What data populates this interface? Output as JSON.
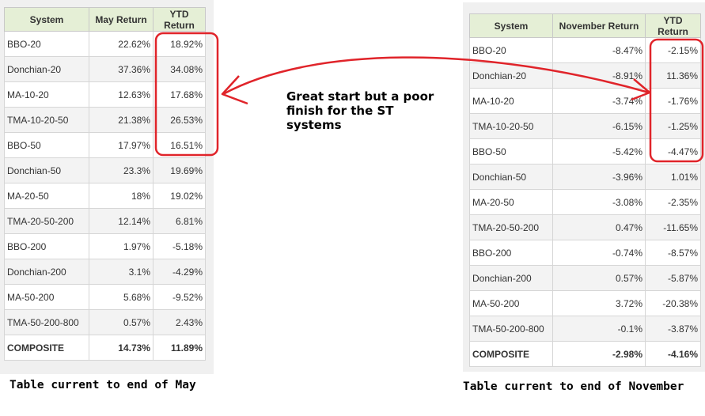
{
  "annotation": "Great start but a poor finish for the ST systems",
  "colors": {
    "header_bg": "#e5efd6",
    "annotation_red": "#e0242a",
    "panel_bg": "#f0f0f0"
  },
  "may_table": {
    "caption": "Table current to end of May",
    "headers": [
      "System",
      "May Return",
      "YTD Return"
    ],
    "rows": [
      {
        "system": "BBO-20",
        "period": "22.62%",
        "ytd": "18.92%"
      },
      {
        "system": "Donchian-20",
        "period": "37.36%",
        "ytd": "34.08%"
      },
      {
        "system": "MA-10-20",
        "period": "12.63%",
        "ytd": "17.68%"
      },
      {
        "system": "TMA-10-20-50",
        "period": "21.38%",
        "ytd": "26.53%"
      },
      {
        "system": "BBO-50",
        "period": "17.97%",
        "ytd": "16.51%"
      },
      {
        "system": "Donchian-50",
        "period": "23.3%",
        "ytd": "19.69%"
      },
      {
        "system": "MA-20-50",
        "period": "18%",
        "ytd": "19.02%"
      },
      {
        "system": "TMA-20-50-200",
        "period": "12.14%",
        "ytd": "6.81%"
      },
      {
        "system": "BBO-200",
        "period": "1.97%",
        "ytd": "-5.18%"
      },
      {
        "system": "Donchian-200",
        "period": "3.1%",
        "ytd": "-4.29%"
      },
      {
        "system": "MA-50-200",
        "period": "5.68%",
        "ytd": "-9.52%"
      },
      {
        "system": "TMA-50-200-800",
        "period": "0.57%",
        "ytd": "2.43%"
      },
      {
        "system": "COMPOSITE",
        "period": "14.73%",
        "ytd": "11.89%"
      }
    ]
  },
  "nov_table": {
    "caption": "Table current to end of November",
    "headers": [
      "System",
      "November Return",
      "YTD Return"
    ],
    "rows": [
      {
        "system": "BBO-20",
        "period": "-8.47%",
        "ytd": "-2.15%"
      },
      {
        "system": "Donchian-20",
        "period": "-8.91%",
        "ytd": "11.36%"
      },
      {
        "system": "MA-10-20",
        "period": "-3.74%",
        "ytd": "-1.76%"
      },
      {
        "system": "TMA-10-20-50",
        "period": "-6.15%",
        "ytd": "-1.25%"
      },
      {
        "system": "BBO-50",
        "period": "-5.42%",
        "ytd": "-4.47%"
      },
      {
        "system": "Donchian-50",
        "period": "-3.96%",
        "ytd": "1.01%"
      },
      {
        "system": "MA-20-50",
        "period": "-3.08%",
        "ytd": "-2.35%"
      },
      {
        "system": "TMA-20-50-200",
        "period": "0.47%",
        "ytd": "-11.65%"
      },
      {
        "system": "BBO-200",
        "period": "-0.74%",
        "ytd": "-8.57%"
      },
      {
        "system": "Donchian-200",
        "period": "0.57%",
        "ytd": "-5.87%"
      },
      {
        "system": "MA-50-200",
        "period": "3.72%",
        "ytd": "-20.38%"
      },
      {
        "system": "TMA-50-200-800",
        "period": "-0.1%",
        "ytd": "-3.87%"
      },
      {
        "system": "COMPOSITE",
        "period": "-2.98%",
        "ytd": "-4.16%"
      }
    ]
  }
}
